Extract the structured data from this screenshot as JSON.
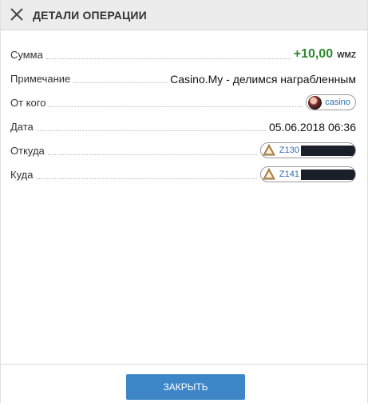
{
  "header": {
    "title": "ДЕТАЛИ ОПЕРАЦИИ",
    "close_icon": "close-icon"
  },
  "details": {
    "amount": {
      "label": "Сумма",
      "value": "+10,00",
      "currency": "WMZ",
      "color": "#2e8b2e"
    },
    "note": {
      "label": "Примечание",
      "value": "Casino.My - делимся награбленным"
    },
    "from": {
      "label": "От кого",
      "name": "casino"
    },
    "date": {
      "label": "Дата",
      "value": "05.06.2018 06:36"
    },
    "source": {
      "label": "Откуда",
      "purse": "Z130"
    },
    "destination": {
      "label": "Куда",
      "purse": "Z141"
    }
  },
  "footer": {
    "close_label": "ЗАКРЫТЬ",
    "accent": "#3d86c8"
  }
}
